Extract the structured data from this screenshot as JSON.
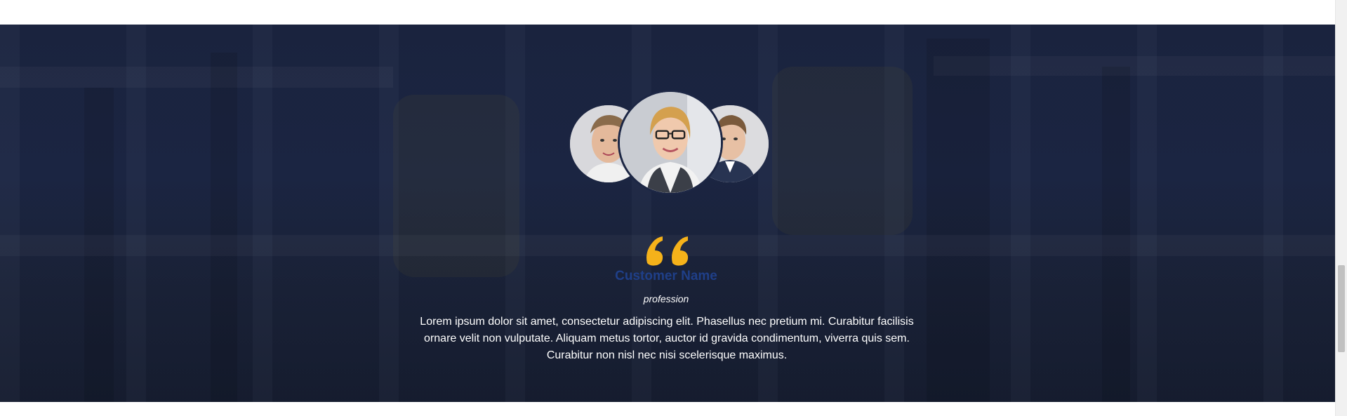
{
  "testimonial": {
    "customer_name": "Customer Name",
    "profession": "profession",
    "text": "Lorem ipsum dolor sit amet, consectetur adipiscing elit. Phasellus nec pretium mi. Curabitur facilisis ornare velit non vulputate. Aliquam metus tortor, auctor id gravida condimentum, viverra quis sem. Curabitur non nisl nec nisi scelerisque maximus."
  },
  "colors": {
    "overlay": "#1c2644",
    "quote_accent": "#f5b21a",
    "name_accent": "#1f3f88"
  },
  "icons": {
    "quote": "quote-open-icon"
  }
}
